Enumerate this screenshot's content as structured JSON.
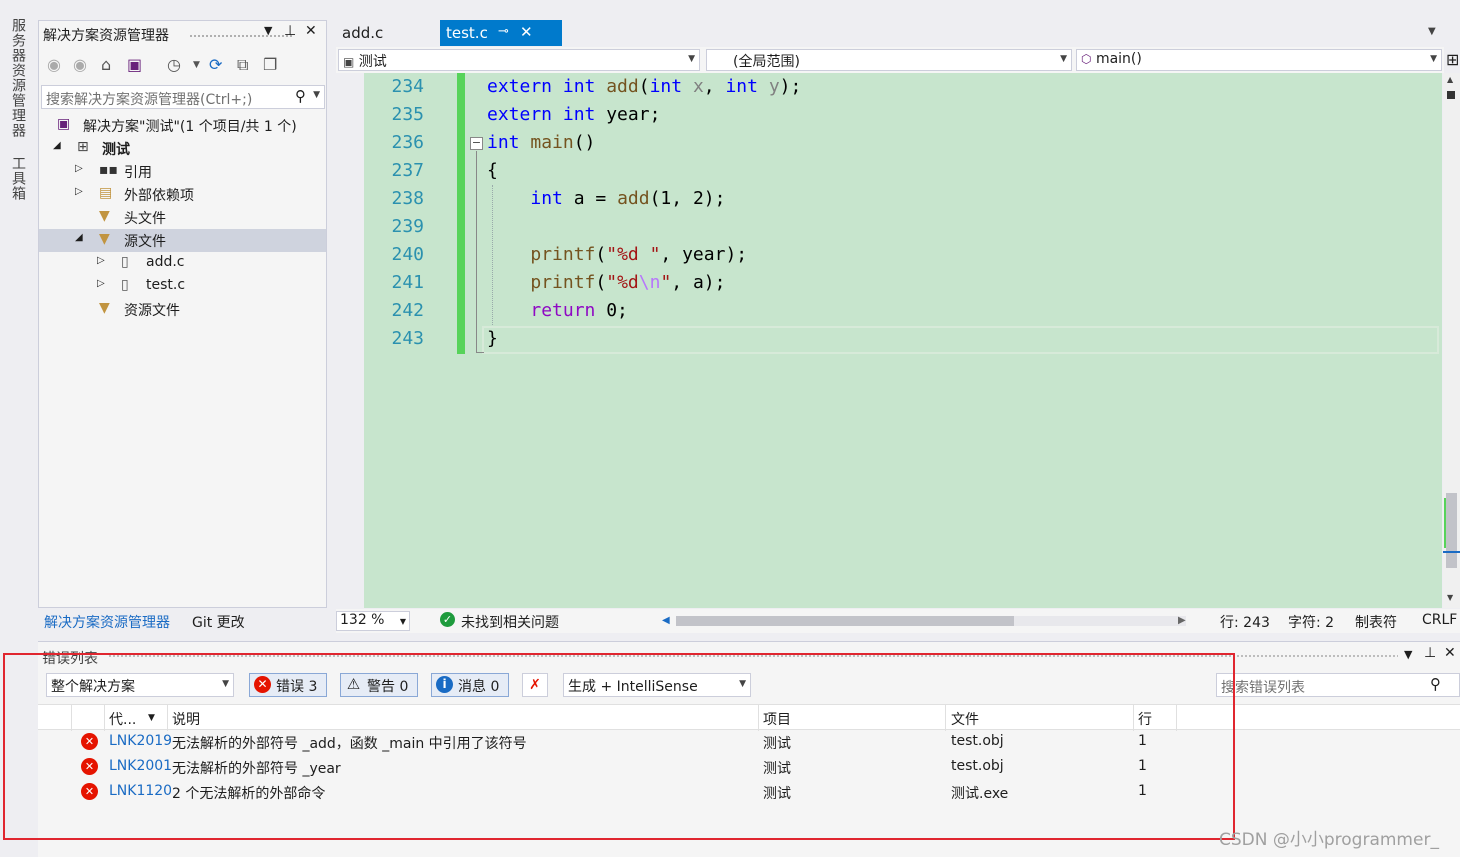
{
  "side_tabs": [
    "服务器资源管理器",
    "工具箱"
  ],
  "solution_explorer": {
    "title": "解决方案资源管理器",
    "search_placeholder": "搜索解决方案资源管理器(Ctrl+;)",
    "tree": [
      {
        "label": "解决方案\"测试\"(1 个项目/共 1 个)",
        "level": 0,
        "arrow": "",
        "icon": "solution-icon"
      },
      {
        "label": "测试",
        "level": 0,
        "arrow": "◢",
        "icon": "project-icon",
        "bold": true
      },
      {
        "label": "引用",
        "level": 1,
        "arrow": "▷",
        "icon": "references-icon"
      },
      {
        "label": "外部依赖项",
        "level": 1,
        "arrow": "▷",
        "icon": "external-deps-icon"
      },
      {
        "label": "头文件",
        "level": 1,
        "arrow": "",
        "icon": "filter-folder-icon"
      },
      {
        "label": "源文件",
        "level": 1,
        "arrow": "◢",
        "icon": "filter-folder-icon",
        "selected": true
      },
      {
        "label": "add.c",
        "level": 2,
        "arrow": "▷",
        "icon": "c-file-icon"
      },
      {
        "label": "test.c",
        "level": 2,
        "arrow": "▷",
        "icon": "c-file-icon"
      },
      {
        "label": "资源文件",
        "level": 1,
        "arrow": "",
        "icon": "filter-folder-icon"
      }
    ],
    "bottom_tabs": [
      "解决方案资源管理器",
      "Git 更改"
    ]
  },
  "editor": {
    "tabs": [
      {
        "label": "add.c",
        "active": false
      },
      {
        "label": "test.c",
        "active": true
      }
    ],
    "nav": {
      "project": "测试",
      "scope": "(全局范围)",
      "member": "main()"
    },
    "line_numbers": [
      "234",
      "235",
      "236",
      "237",
      "238",
      "239",
      "240",
      "241",
      "242",
      "243"
    ],
    "lines": [
      [
        {
          "t": "extern ",
          "c": "kw"
        },
        {
          "t": "int ",
          "c": "kw"
        },
        {
          "t": "add",
          "c": "fn"
        },
        {
          "t": "(",
          "c": ""
        },
        {
          "t": "int ",
          "c": "kw"
        },
        {
          "t": "x",
          "c": "pn"
        },
        {
          "t": ", ",
          "c": ""
        },
        {
          "t": "int ",
          "c": "kw"
        },
        {
          "t": "y",
          "c": "pn"
        },
        {
          "t": ");",
          "c": ""
        }
      ],
      [
        {
          "t": "extern ",
          "c": "kw"
        },
        {
          "t": "int ",
          "c": "kw"
        },
        {
          "t": "year;",
          "c": ""
        }
      ],
      [
        {
          "t": "int ",
          "c": "kw"
        },
        {
          "t": "main",
          "c": "fn"
        },
        {
          "t": "()",
          "c": ""
        }
      ],
      [
        {
          "t": "{",
          "c": ""
        }
      ],
      [
        {
          "t": "    ",
          "c": ""
        },
        {
          "t": "int ",
          "c": "kw"
        },
        {
          "t": "a = ",
          "c": ""
        },
        {
          "t": "add",
          "c": "fn"
        },
        {
          "t": "(1, 2);",
          "c": ""
        }
      ],
      [
        {
          "t": "",
          "c": ""
        }
      ],
      [
        {
          "t": "    ",
          "c": ""
        },
        {
          "t": "printf",
          "c": "fn"
        },
        {
          "t": "(",
          "c": ""
        },
        {
          "t": "\"%d \"",
          "c": "str"
        },
        {
          "t": ", year);",
          "c": ""
        }
      ],
      [
        {
          "t": "    ",
          "c": ""
        },
        {
          "t": "printf",
          "c": "fn"
        },
        {
          "t": "(",
          "c": ""
        },
        {
          "t": "\"%d",
          "c": "str"
        },
        {
          "t": "\\n",
          "c": "esc"
        },
        {
          "t": "\"",
          "c": "str"
        },
        {
          "t": ", a);",
          "c": ""
        }
      ],
      [
        {
          "t": "    ",
          "c": ""
        },
        {
          "t": "return ",
          "c": "ret"
        },
        {
          "t": "0;",
          "c": ""
        }
      ],
      [
        {
          "t": "}",
          "c": ""
        }
      ]
    ]
  },
  "status_bar": {
    "zoom": "132 %",
    "issues": "未找到相关问题",
    "line": "行: 243",
    "char": "字符: 2",
    "indent": "制表符",
    "eol": "CRLF"
  },
  "error_list": {
    "title": "错误列表",
    "scope": "整个解决方案",
    "errors_btn": "错误 3",
    "warnings_btn": "警告 0",
    "messages_btn": "消息 0",
    "source": "生成 + IntelliSense",
    "search_placeholder": "搜索错误列表",
    "columns": {
      "code": "代...",
      "desc": "说明",
      "project": "项目",
      "file": "文件",
      "line": "行"
    },
    "rows": [
      {
        "code": "LNK2019",
        "desc": "无法解析的外部符号 _add，函数 _main 中引用了该符号",
        "project": "测试",
        "file": "test.obj",
        "line": "1"
      },
      {
        "code": "LNK2001",
        "desc": "无法解析的外部符号 _year",
        "project": "测试",
        "file": "test.obj",
        "line": "1"
      },
      {
        "code": "LNK1120",
        "desc": "2 个无法解析的外部命令",
        "project": "测试",
        "file": "测试.exe",
        "line": "1"
      }
    ]
  },
  "watermark": "CSDN @小小programmer_"
}
